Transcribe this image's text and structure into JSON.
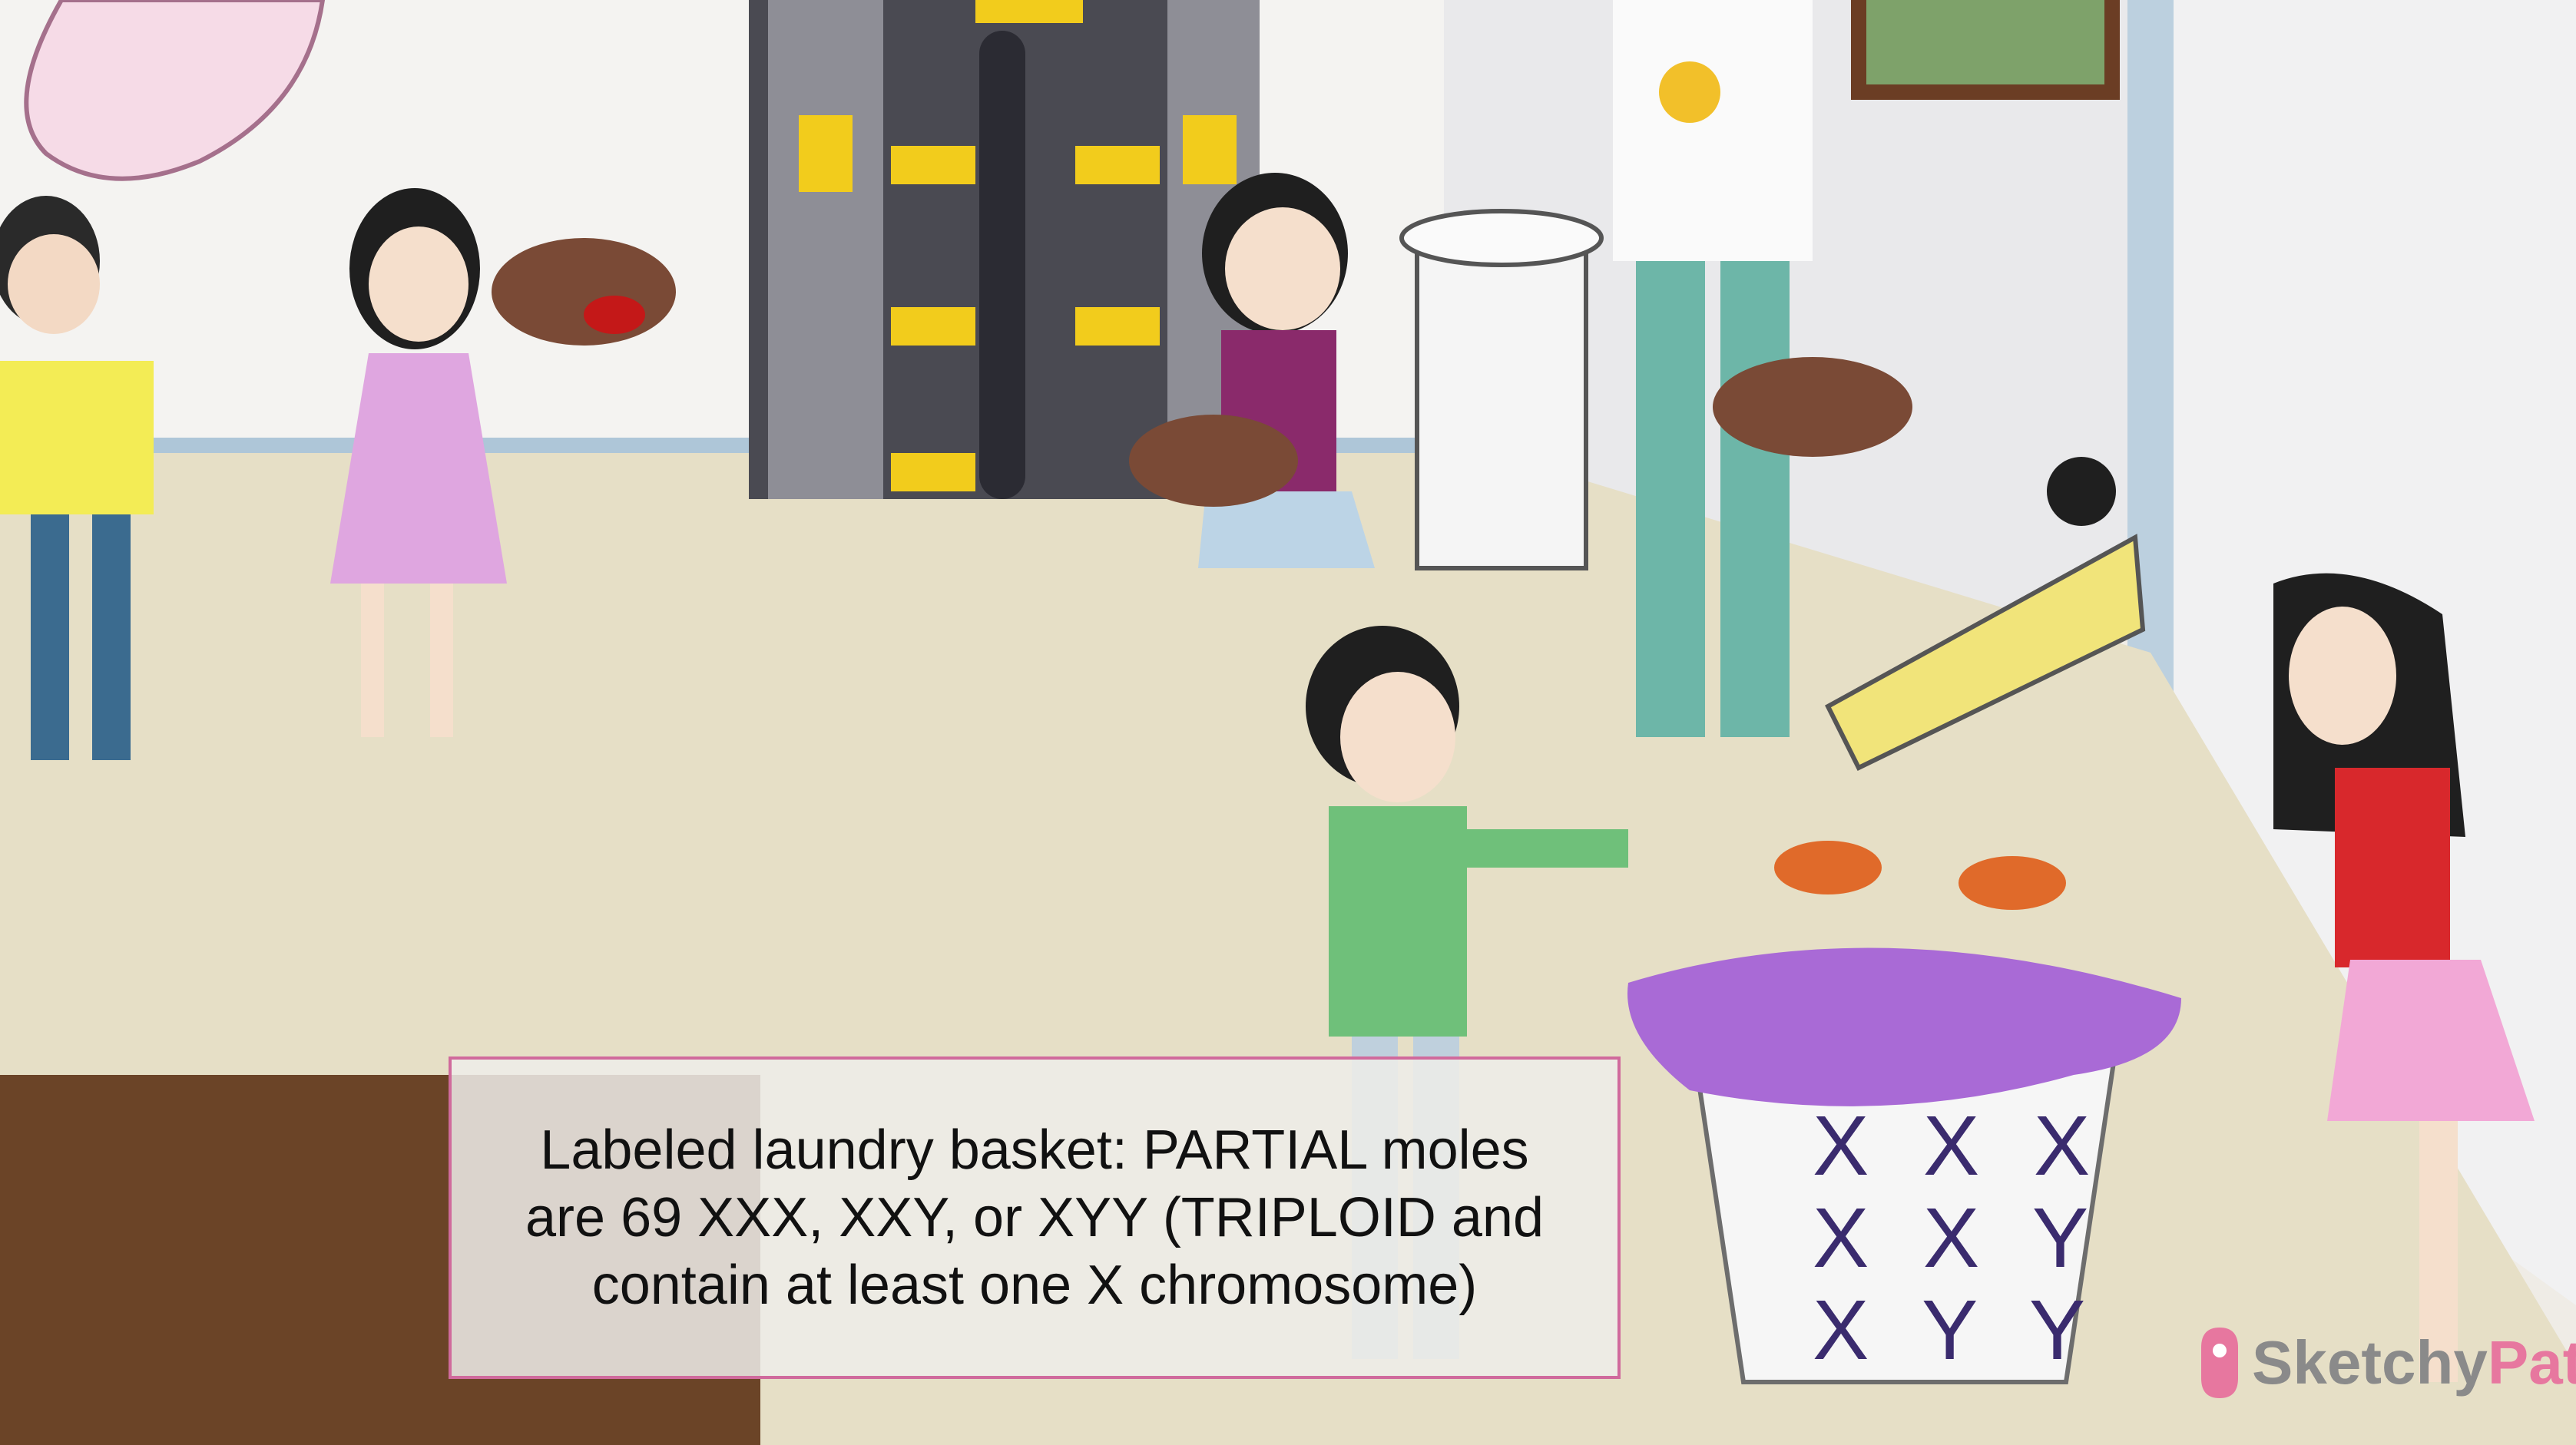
{
  "caption": {
    "text": "Labeled laundry basket: PARTIAL moles\nare 69 XXX, XXY, or XYY (TRIPLOID and\ncontain at least one X chromosome)"
  },
  "basket": {
    "labels": [
      "X X X",
      "X X Y",
      "X Y Y"
    ]
  },
  "watermark": {
    "part1": "Sketchy",
    "part2": "Path"
  },
  "colors": {
    "callout_border": "#d06a9c",
    "basket_mark": "#3a2b6e",
    "laundry": "#a96ad6",
    "watermark_pink": "#e7779f",
    "floor": "#e6dfc6",
    "wall": "#f4f3f1"
  }
}
